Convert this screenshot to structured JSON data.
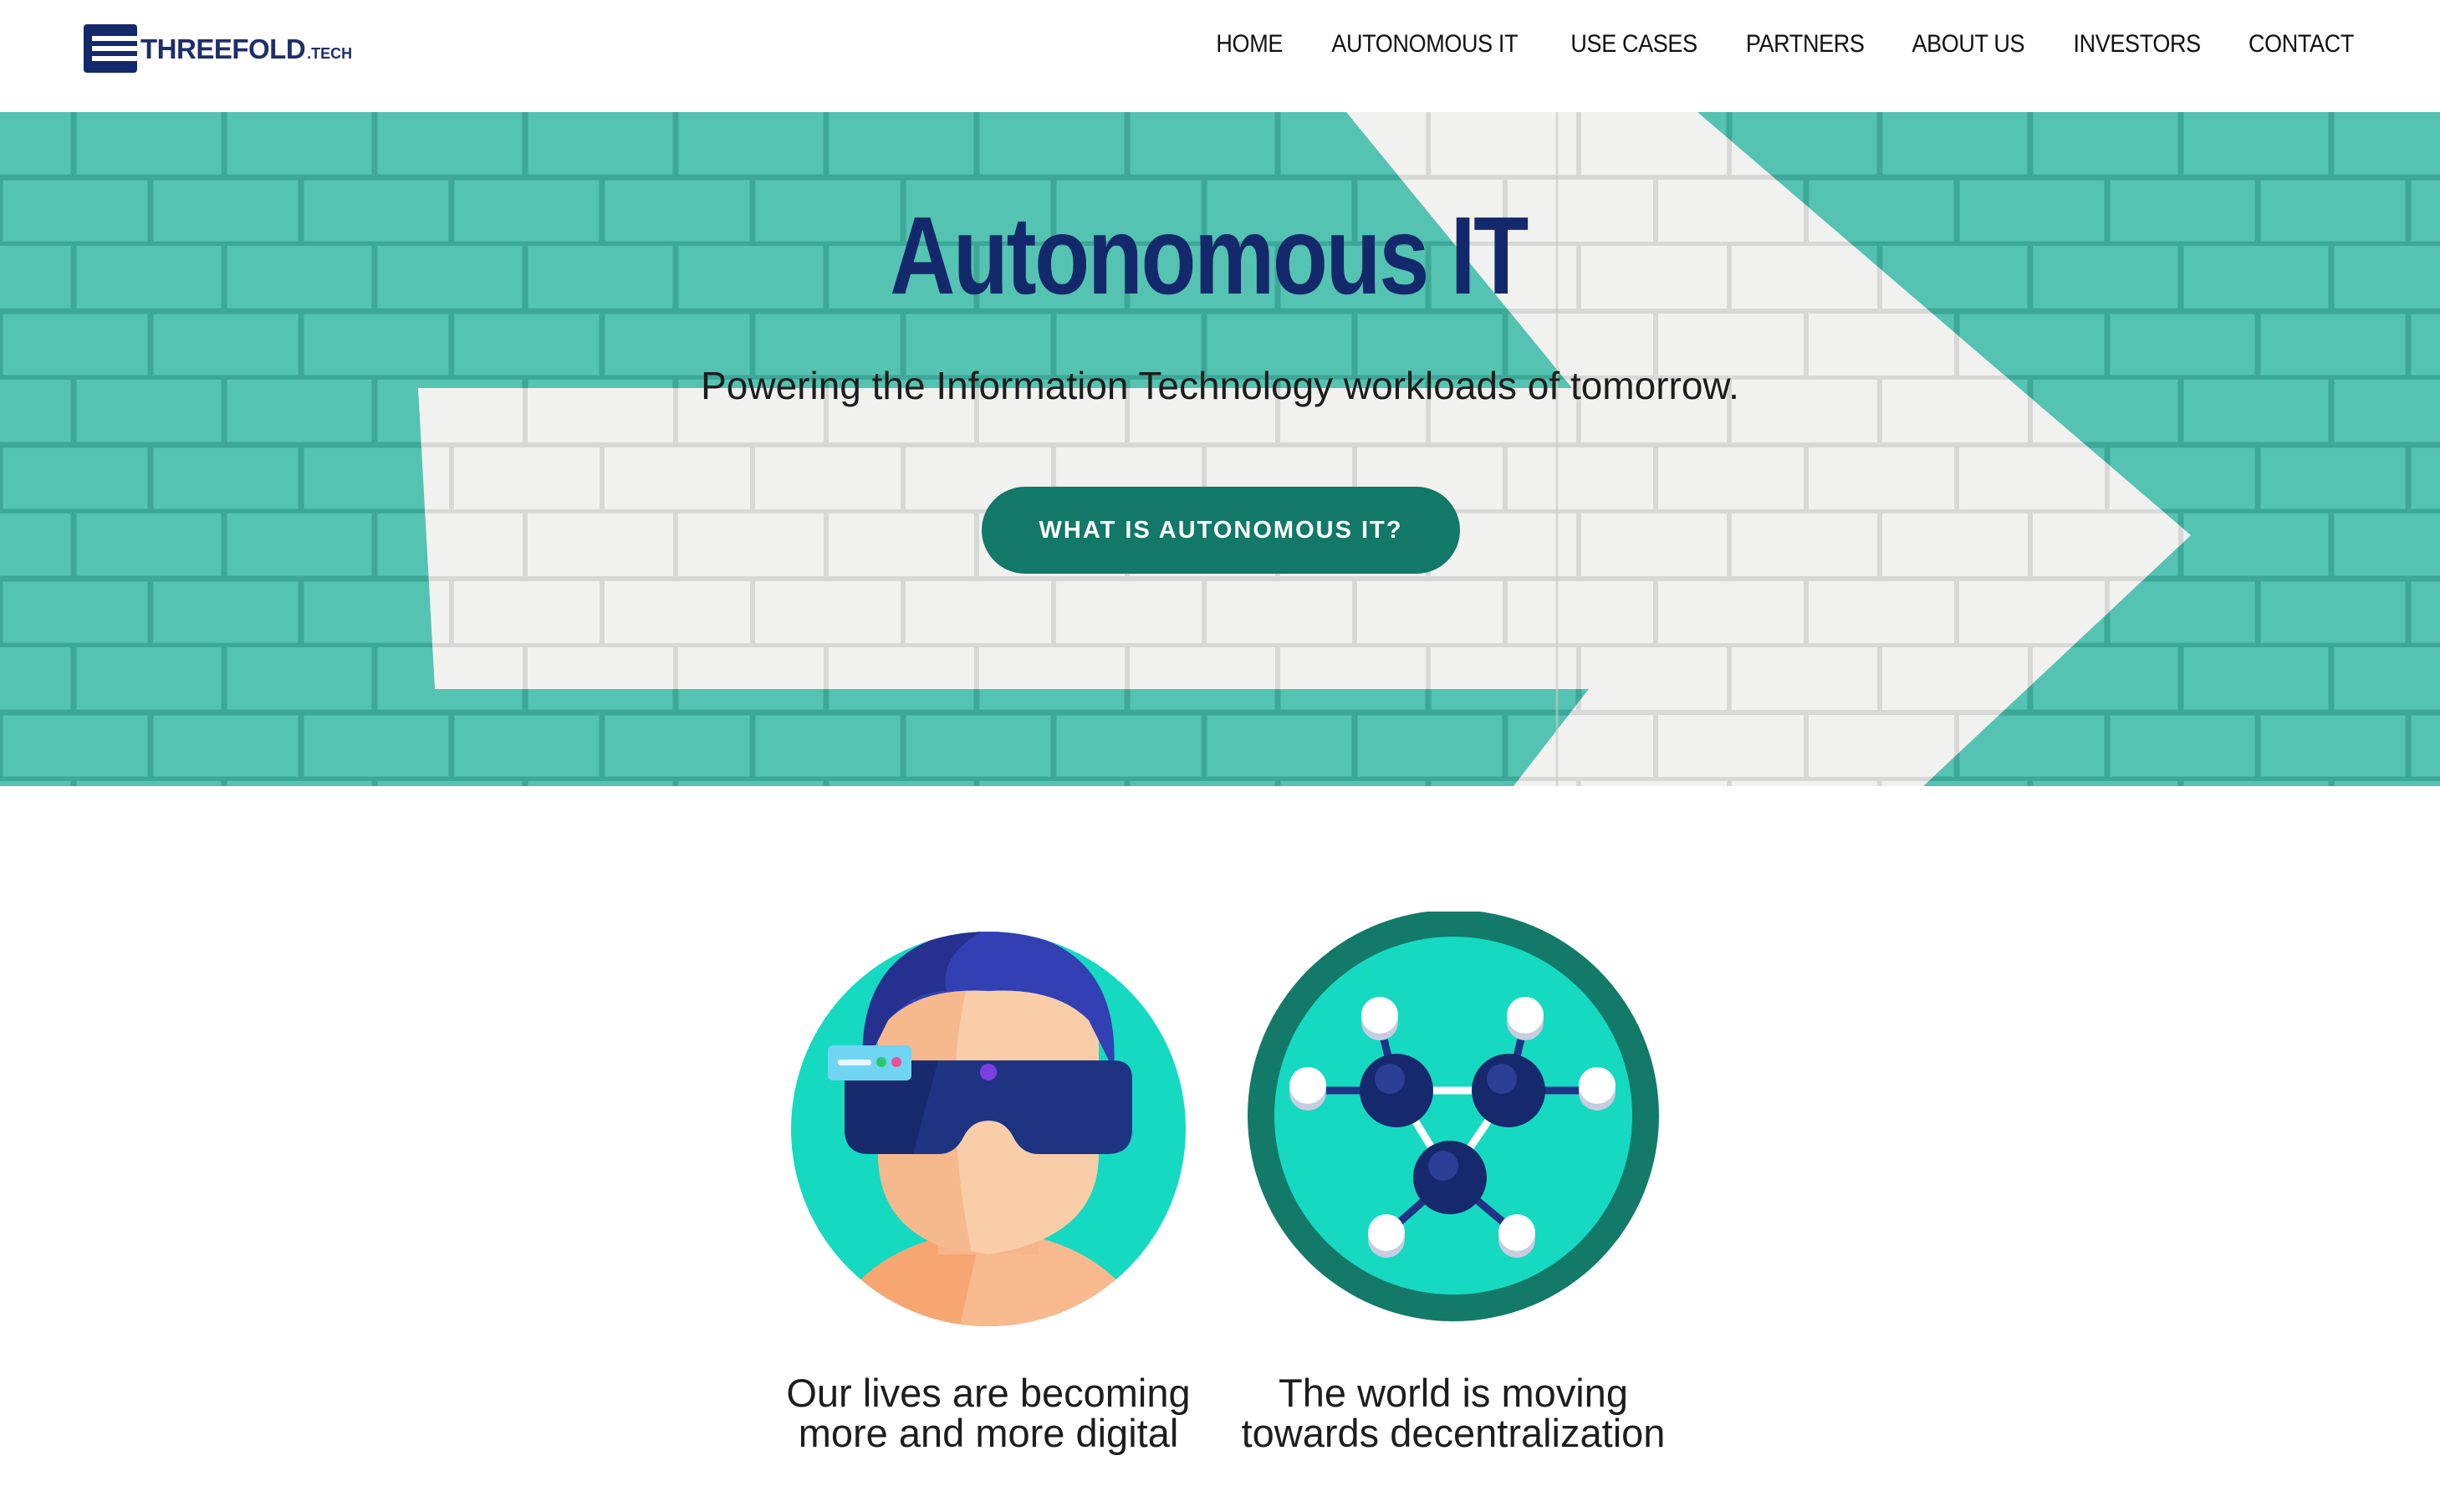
{
  "header": {
    "logo": {
      "brand": "THREEFOLD",
      "suffix": ".TECH",
      "icon": "threefold-logo-icon"
    },
    "nav": [
      {
        "label": "HOME"
      },
      {
        "label": "AUTONOMOUS IT"
      },
      {
        "label": "USE CASES"
      },
      {
        "label": "PARTNERS"
      },
      {
        "label": "ABOUT US"
      },
      {
        "label": "INVESTORS"
      },
      {
        "label": "CONTACT"
      }
    ]
  },
  "hero": {
    "title": "Autonomous IT",
    "subtitle": "Powering the Information Technology workloads of tomorrow.",
    "cta_label": "WHAT IS AUTONOMOUS IT?",
    "background": "teal-brick-wall-with-white-arrow"
  },
  "features": [
    {
      "caption": "Our lives are becoming more and more digital",
      "icon": "vr-headset-person-icon"
    },
    {
      "caption": "The world is moving towards decentralization",
      "icon": "molecule-network-icon"
    }
  ],
  "colors": {
    "navy": "#14296b",
    "brand_navy": "#1d2e6b",
    "teal_button": "#127867",
    "wall_teal": "#55c3b1",
    "circle_teal": "#16d9c1",
    "ring_teal": "#137a69"
  }
}
